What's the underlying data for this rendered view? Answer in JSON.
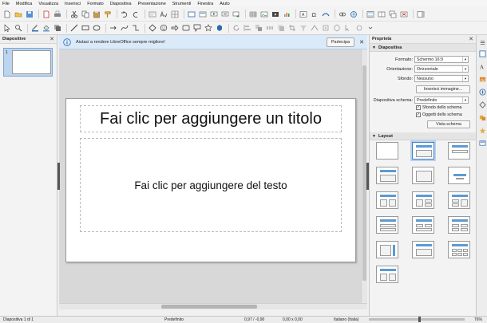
{
  "menu": [
    "File",
    "Modifica",
    "Visualizza",
    "Inserisci",
    "Formato",
    "Diapositiva",
    "Presentazione",
    "Strumenti",
    "Finestra",
    "Aiuto"
  ],
  "slides_pane": {
    "title": "Diapositive",
    "thumb_number": "1"
  },
  "infobar": {
    "text": "Aiutaci a rendere LibreOffice sempre migliore!",
    "button": "Partecipa"
  },
  "slide": {
    "title_placeholder": "Fai clic per aggiungere un titolo",
    "body_placeholder": "Fai clic per aggiungere del testo"
  },
  "properties": {
    "title": "Proprietà",
    "section_slide": "Diapositiva",
    "format_label": "Formato:",
    "format_value": "Schermo 16:9",
    "orientation_label": "Orientazione:",
    "orientation_value": "Orizzontale",
    "background_label": "Sfondo:",
    "background_value": "Nessuno",
    "insert_image_button": "Inserisci immagine...",
    "master_label": "Diapositiva schema:",
    "master_value": "Predefinito",
    "master_background": "Sfondo dello schema",
    "master_objects": "Oggetti dello schema",
    "master_view_button": "Vista schema",
    "section_layout": "Layout"
  },
  "status": {
    "slide": "Diapositiva 1 di 1",
    "master": "Predefinito",
    "position": "0,97 / -0,90",
    "size": "0,00 x 0,00",
    "language": "Italiano (Italia)",
    "zoom": "76%"
  },
  "colors": {
    "accent": "#5b9bd5",
    "infobar": "#dbeaf8",
    "canvas": "#d8d8d8"
  }
}
